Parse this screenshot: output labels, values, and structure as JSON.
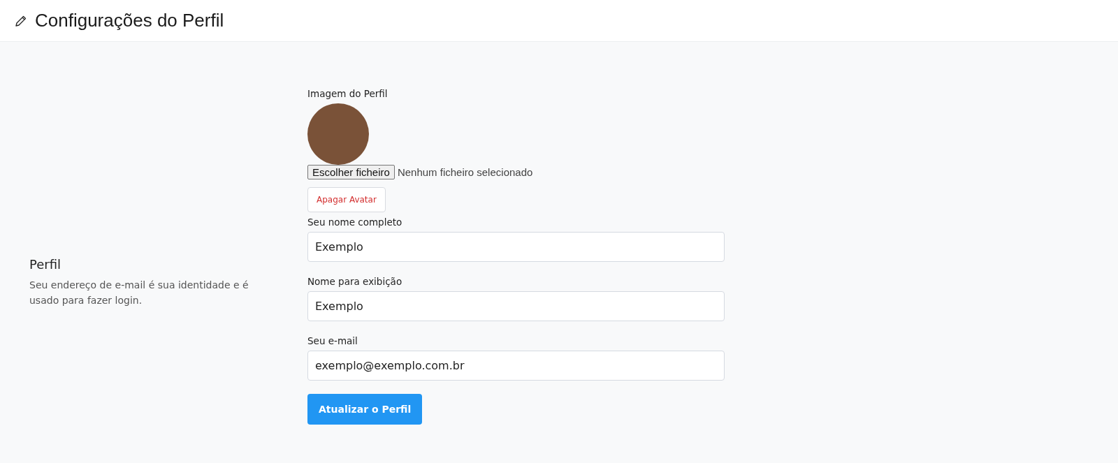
{
  "header": {
    "title": "Configurações do Perfil"
  },
  "section": {
    "title": "Perfil",
    "description": "Seu endereço de e-mail é sua identidade e é usado para fazer login."
  },
  "avatar": {
    "label": "Imagem do Perfil"
  },
  "file_picker": {
    "button": "Escolher ficheiro",
    "status": "Nenhum ficheiro selecionado"
  },
  "delete_button": "Apagar Avatar",
  "fields": [
    {
      "label": "Seu nome completo",
      "value": "Exemplo"
    },
    {
      "label": "Nome para exibição",
      "value": "Exemplo"
    },
    {
      "label": "Seu e-mail",
      "value": "exemplo@exemplo.com.br"
    }
  ],
  "submit_button": "Atualizar o Perfil"
}
